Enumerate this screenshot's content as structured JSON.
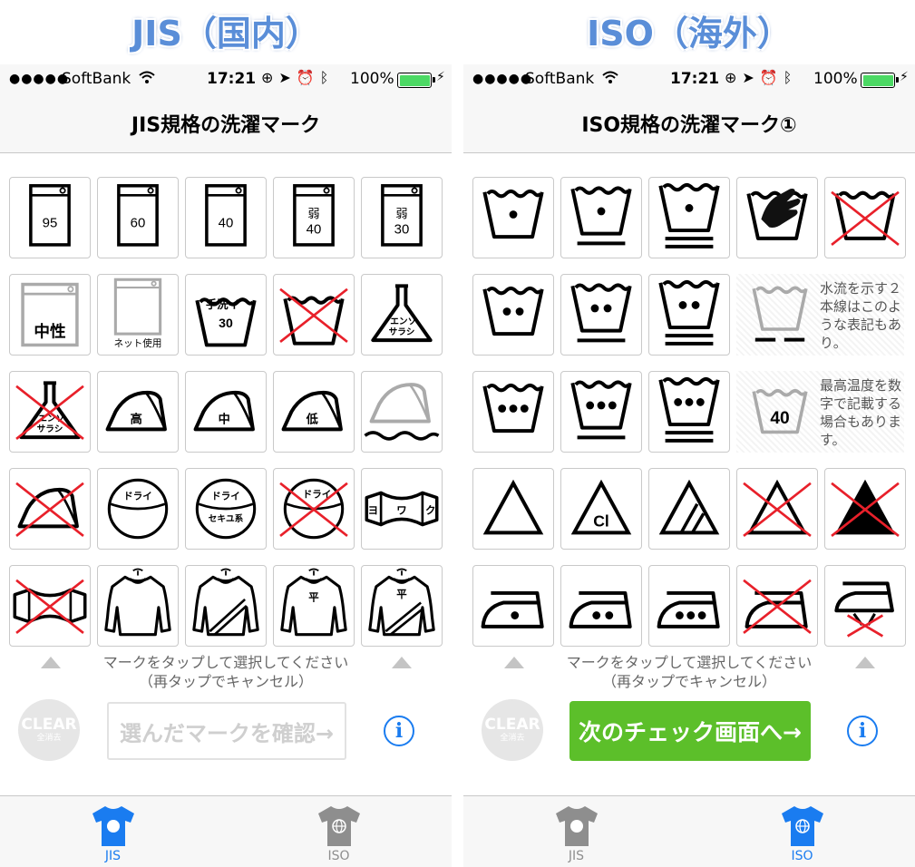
{
  "headings": {
    "left": "JIS（国内）",
    "right": "ISO（海外）"
  },
  "colors": {
    "accent_blue": "#1a7cf0",
    "next_green": "#5cbf2a",
    "tab_inactive": "#8e8e8e",
    "battery_green": "#4cd964",
    "cross_red": "#e8202a"
  },
  "status_bar": {
    "dots": "●●●●●",
    "carrier": "SoftBank",
    "wifi": "wifi-icon",
    "time": "17:21",
    "icons": [
      "rotation-lock-icon",
      "location-arrow-icon",
      "alarm-icon",
      "bluetooth-icon"
    ],
    "battery": "100%",
    "battery_level": 1.0
  },
  "jis_screen": {
    "title": "JIS規格の洗濯マーク",
    "marks": [
      {
        "id": "wash-95",
        "text": "95"
      },
      {
        "id": "wash-60",
        "text": "60"
      },
      {
        "id": "wash-40",
        "text": "40"
      },
      {
        "id": "wash-weak-40",
        "text1": "弱",
        "text2": "40"
      },
      {
        "id": "wash-weak-30",
        "text1": "弱",
        "text2": "30"
      },
      {
        "id": "wash-neutral",
        "text": "中性"
      },
      {
        "id": "wash-net",
        "text": "ネット使用"
      },
      {
        "id": "hand-wash-30",
        "text1": "手洗イ",
        "text2": "30"
      },
      {
        "id": "no-wash"
      },
      {
        "id": "chlorine-bleach",
        "text1": "エンソ",
        "text2": "サラシ"
      },
      {
        "id": "no-chlorine-bleach",
        "text1": "エンソ",
        "text2": "サラシ"
      },
      {
        "id": "iron-high",
        "text": "高"
      },
      {
        "id": "iron-medium",
        "text": "中"
      },
      {
        "id": "iron-low",
        "text": "低"
      },
      {
        "id": "iron-cloth"
      },
      {
        "id": "no-iron"
      },
      {
        "id": "dry-clean",
        "text": "ドライ"
      },
      {
        "id": "dry-clean-petroleum",
        "text1": "ドライ",
        "text2": "セキユ系"
      },
      {
        "id": "no-dry-clean",
        "text": "ドライ"
      },
      {
        "id": "wring-weak",
        "text1": "ヨ",
        "text2": "ワ",
        "text3": "ク"
      },
      {
        "id": "no-wring"
      },
      {
        "id": "hang-dry"
      },
      {
        "id": "hang-dry-shade"
      },
      {
        "id": "flat-dry",
        "text": "平"
      },
      {
        "id": "flat-dry-shade",
        "text": "平"
      }
    ],
    "instruction_line1": "マークをタップして選択してください",
    "instruction_line2": "（再タップでキャンセル）",
    "clear_label": "CLEAR",
    "clear_sub": "全消去",
    "confirm_label": "選んだマークを確認→",
    "info_label": "i"
  },
  "iso_screen": {
    "title": "ISO規格の洗濯マーク①",
    "marks": [
      {
        "id": "wash-1dot"
      },
      {
        "id": "wash-1dot-bar"
      },
      {
        "id": "wash-1dot-2bar"
      },
      {
        "id": "hand-wash"
      },
      {
        "id": "no-wash"
      },
      {
        "id": "wash-2dot"
      },
      {
        "id": "wash-2dot-bar"
      },
      {
        "id": "wash-2dot-2bar"
      },
      {
        "id": "wash-3dot"
      },
      {
        "id": "wash-3dot-bar"
      },
      {
        "id": "wash-3dot-2bar"
      },
      {
        "id": "bleach-any"
      },
      {
        "id": "bleach-chlorine",
        "text": "Cl"
      },
      {
        "id": "bleach-oxygen"
      },
      {
        "id": "no-bleach"
      },
      {
        "id": "no-bleach-filled"
      },
      {
        "id": "iron-1dot"
      },
      {
        "id": "iron-2dot"
      },
      {
        "id": "iron-3dot"
      },
      {
        "id": "no-iron"
      },
      {
        "id": "no-steam"
      }
    ],
    "note1": "水流を示す２本線はこのような表記もあり。",
    "note2": "最高温度を数字で記載する場合もあります。",
    "note2_value": "40",
    "instruction_line1": "マークをタップして選択してください",
    "instruction_line2": "（再タップでキャンセル）",
    "clear_label": "CLEAR",
    "clear_sub": "全消去",
    "next_label": "次のチェック画面へ→",
    "info_label": "i"
  },
  "tabs": [
    {
      "label": "JIS",
      "icon": "tshirt-circle-icon"
    },
    {
      "label": "ISO",
      "icon": "tshirt-globe-icon"
    }
  ]
}
